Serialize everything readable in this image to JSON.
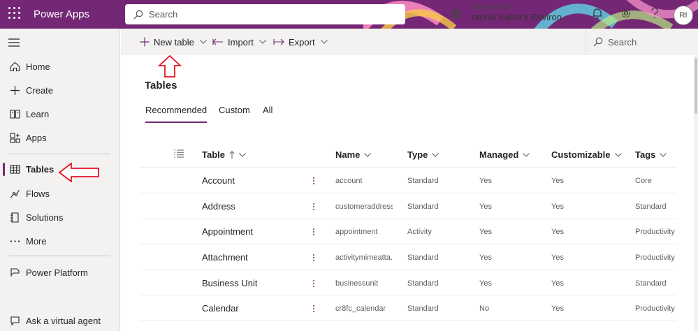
{
  "header": {
    "app_title": "Power Apps",
    "search_placeholder": "Search",
    "environment_label": "Environment",
    "environment_name": "rachel irabor's Environ...",
    "avatar_initials": "RI",
    "brand_color": "#742774"
  },
  "sidebar": {
    "items": [
      {
        "label": "Home",
        "icon": "home-icon"
      },
      {
        "label": "Create",
        "icon": "plus-icon"
      },
      {
        "label": "Learn",
        "icon": "book-icon"
      },
      {
        "label": "Apps",
        "icon": "apps-icon"
      },
      {
        "label": "Tables",
        "icon": "table-icon",
        "active": true
      },
      {
        "label": "Flows",
        "icon": "flow-icon"
      },
      {
        "label": "Solutions",
        "icon": "solutions-icon"
      },
      {
        "label": "More",
        "icon": "more-icon"
      },
      {
        "label": "Power Platform",
        "icon": "power-platform-icon"
      },
      {
        "label": "Ask a virtual agent",
        "icon": "chat-icon"
      }
    ]
  },
  "toolbar": {
    "new_table_label": "New table",
    "import_label": "Import",
    "export_label": "Export",
    "search_label": "Search"
  },
  "main": {
    "title": "Tables",
    "tabs": [
      {
        "label": "Recommended",
        "active": true
      },
      {
        "label": "Custom"
      },
      {
        "label": "All"
      }
    ],
    "columns": {
      "table": "Table",
      "name": "Name",
      "type": "Type",
      "managed": "Managed",
      "customizable": "Customizable",
      "tags": "Tags"
    },
    "rows": [
      {
        "table": "Account",
        "name": "account",
        "type": "Standard",
        "managed": "Yes",
        "customizable": "Yes",
        "tags": "Core"
      },
      {
        "table": "Address",
        "name": "customeraddress",
        "type": "Standard",
        "managed": "Yes",
        "customizable": "Yes",
        "tags": "Standard"
      },
      {
        "table": "Appointment",
        "name": "appointment",
        "type": "Activity",
        "managed": "Yes",
        "customizable": "Yes",
        "tags": "Productivity"
      },
      {
        "table": "Attachment",
        "name": "activitymimeatta...",
        "type": "Standard",
        "managed": "Yes",
        "customizable": "Yes",
        "tags": "Productivity"
      },
      {
        "table": "Business Unit",
        "name": "businessunit",
        "type": "Standard",
        "managed": "Yes",
        "customizable": "Yes",
        "tags": "Standard"
      },
      {
        "table": "Calendar",
        "name": "cr8fc_calendar",
        "type": "Standard",
        "managed": "No",
        "customizable": "Yes",
        "tags": "Productivity"
      }
    ]
  },
  "annotation_color": "#e81123"
}
